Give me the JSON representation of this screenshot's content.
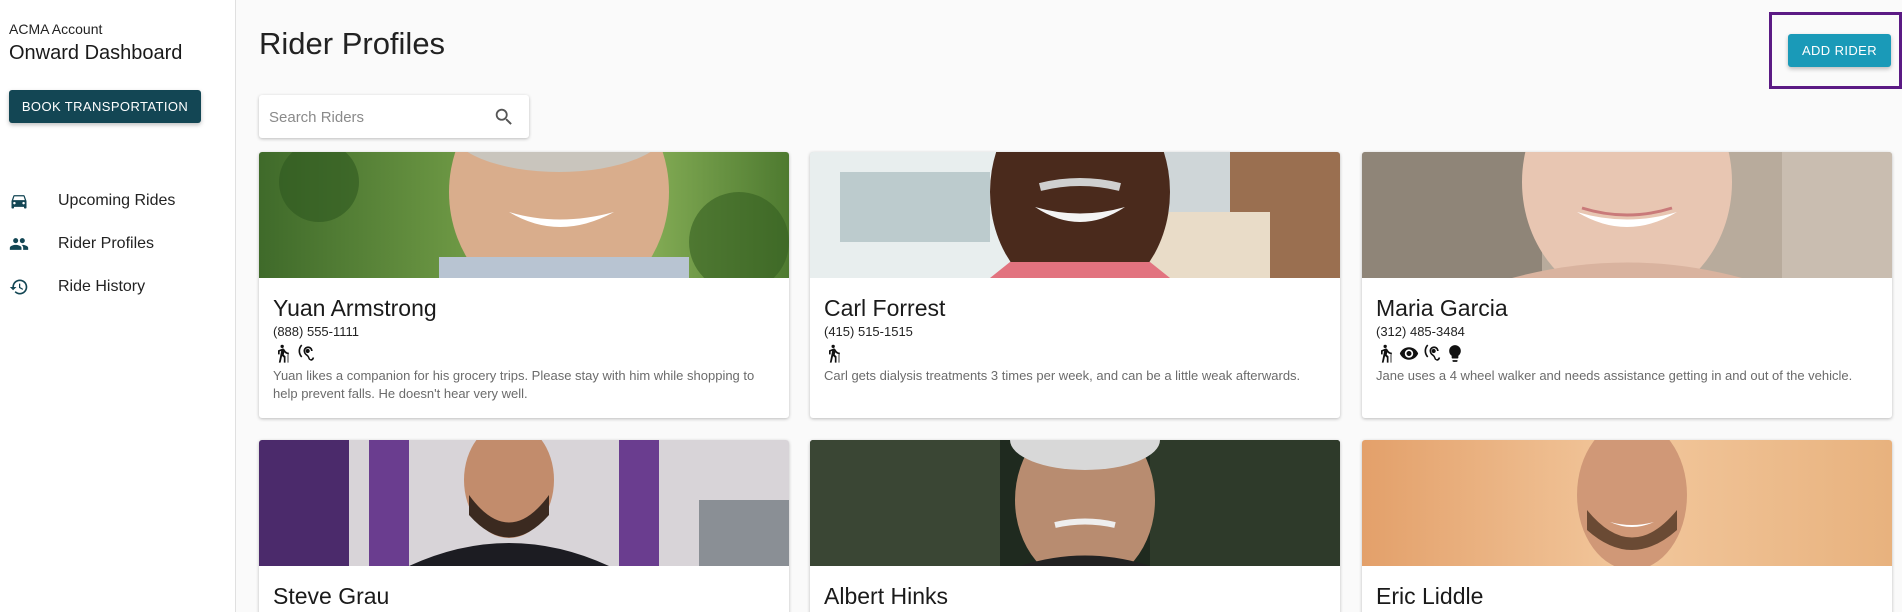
{
  "sidebar": {
    "account_label": "ACMA Account",
    "dashboard_title": "Onward Dashboard",
    "book_button": "BOOK TRANSPORTATION",
    "nav": [
      {
        "label": "Upcoming Rides",
        "icon": "car-icon"
      },
      {
        "label": "Rider Profiles",
        "icon": "people-icon"
      },
      {
        "label": "Ride History",
        "icon": "history-icon"
      }
    ]
  },
  "main": {
    "page_title": "Rider Profiles",
    "search_placeholder": "Search Riders",
    "search_value": "",
    "add_button": "ADD RIDER",
    "accent_color": "#1a9ab8",
    "primary_color": "#134654",
    "highlight_color": "#5b1a84"
  },
  "riders": [
    {
      "name": "Yuan Armstrong",
      "phone": "(888) 555-1111",
      "needs": [
        "walking-cane-icon",
        "hearing-impaired-icon"
      ],
      "notes": "Yuan likes a companion for his grocery trips. Please stay with him while shopping to help prevent falls. He doesn't hear very well."
    },
    {
      "name": "Carl Forrest",
      "phone": "(415) 515-1515",
      "needs": [
        "walking-cane-icon"
      ],
      "notes": "Carl gets dialysis treatments 3 times per week, and can be a little weak afterwards."
    },
    {
      "name": "Maria Garcia",
      "phone": "(312) 485-3484",
      "needs": [
        "walking-cane-icon",
        "vision-icon",
        "hearing-impaired-icon",
        "cognitive-icon"
      ],
      "notes": "Jane uses a 4 wheel walker and needs assistance getting in and out of the vehicle."
    },
    {
      "name": "Steve Grau"
    },
    {
      "name": "Albert Hinks"
    },
    {
      "name": "Eric Liddle"
    }
  ]
}
